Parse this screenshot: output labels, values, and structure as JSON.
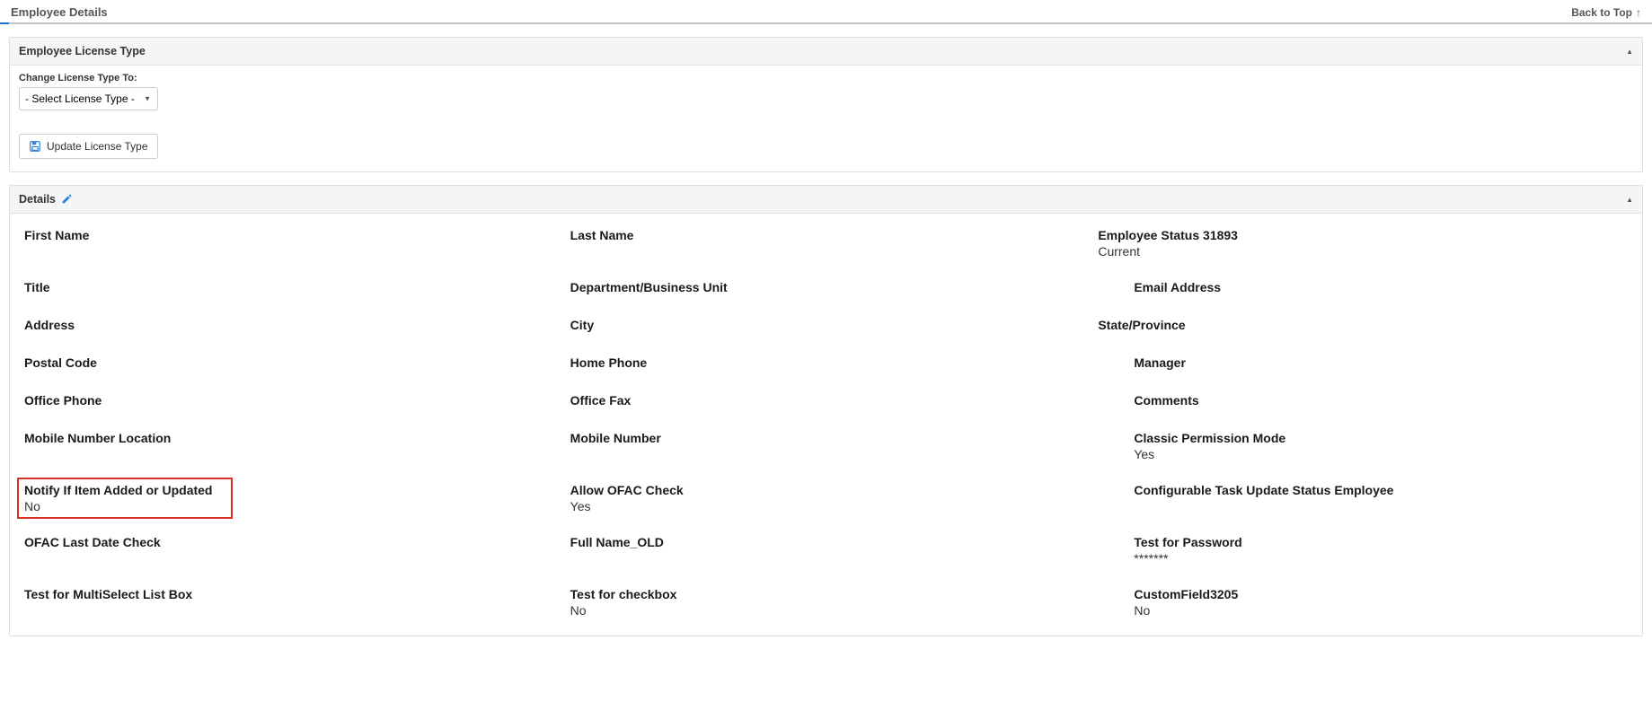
{
  "header": {
    "title": "Employee Details",
    "back_to_top": "Back to Top"
  },
  "license_panel": {
    "title": "Employee License Type",
    "change_label": "Change License Type To:",
    "select_placeholder": "- Select License Type -",
    "update_button": "Update License Type"
  },
  "details_panel": {
    "title": "Details",
    "fields": {
      "first_name": {
        "label": "First Name",
        "value": ""
      },
      "last_name": {
        "label": "Last Name",
        "value": ""
      },
      "employee_status": {
        "label": "Employee Status 31893",
        "value": "Current"
      },
      "title": {
        "label": "Title",
        "value": ""
      },
      "department": {
        "label": "Department/Business Unit",
        "value": ""
      },
      "email": {
        "label": "Email Address",
        "value": ""
      },
      "address": {
        "label": "Address",
        "value": ""
      },
      "city": {
        "label": "City",
        "value": ""
      },
      "state": {
        "label": "State/Province",
        "value": ""
      },
      "postal_code": {
        "label": "Postal Code",
        "value": ""
      },
      "home_phone": {
        "label": "Home Phone",
        "value": ""
      },
      "manager": {
        "label": "Manager",
        "value": ""
      },
      "office_phone": {
        "label": "Office Phone",
        "value": ""
      },
      "office_fax": {
        "label": "Office Fax",
        "value": ""
      },
      "comments": {
        "label": "Comments",
        "value": ""
      },
      "mobile_location": {
        "label": "Mobile Number Location",
        "value": ""
      },
      "mobile_number": {
        "label": "Mobile Number",
        "value": ""
      },
      "classic_permission": {
        "label": "Classic Permission Mode",
        "value": "Yes"
      },
      "notify_added": {
        "label": "Notify If Item Added or Updated",
        "value": "No"
      },
      "allow_ofac": {
        "label": "Allow OFAC Check",
        "value": "Yes"
      },
      "configurable_task": {
        "label": "Configurable Task Update Status Employee",
        "value": ""
      },
      "ofac_last": {
        "label": "OFAC Last Date Check",
        "value": ""
      },
      "full_name_old": {
        "label": "Full Name_OLD",
        "value": ""
      },
      "test_password": {
        "label": "Test for Password",
        "value": "*******"
      },
      "test_multiselect": {
        "label": "Test for MultiSelect List Box",
        "value": ""
      },
      "test_checkbox": {
        "label": "Test for checkbox",
        "value": "No"
      },
      "custom_field_3205": {
        "label": "CustomField3205",
        "value": "No"
      }
    }
  }
}
